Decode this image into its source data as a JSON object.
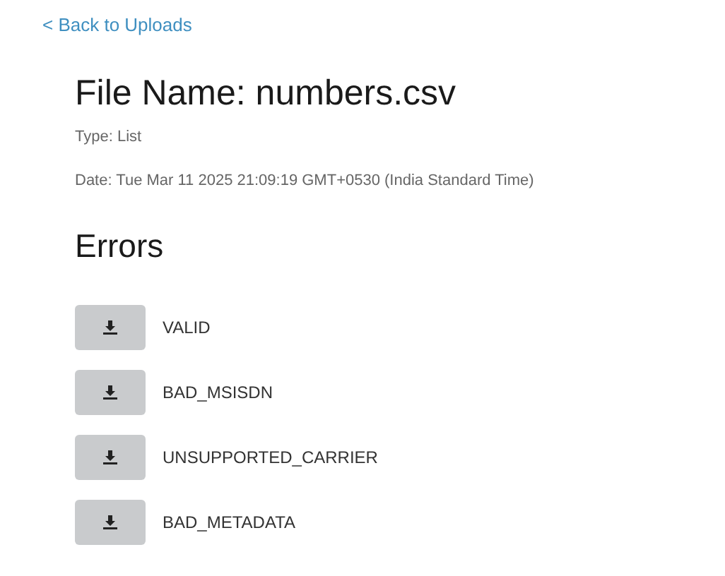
{
  "back_link": "< Back to Uploads",
  "file_name": "File Name: numbers.csv",
  "type": "Type: List",
  "date": "Date: Tue Mar 11 2025 21:09:19 GMT+0530 (India Standard Time)",
  "errors_heading": "Errors",
  "errors": [
    {
      "label": "VALID"
    },
    {
      "label": "BAD_MSISDN"
    },
    {
      "label": "UNSUPPORTED_CARRIER"
    },
    {
      "label": "BAD_METADATA"
    }
  ]
}
